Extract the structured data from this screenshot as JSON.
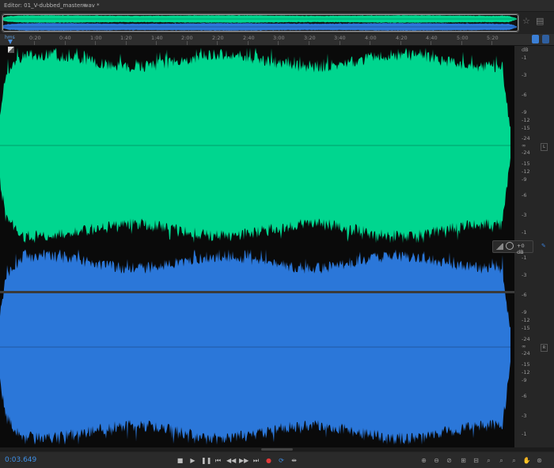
{
  "editor": {
    "title": "Editor: 01_V-dubbed_master.wav *",
    "menu_icon": "hamburger-menu-icon"
  },
  "colors": {
    "left_channel": "#00d68f",
    "right_channel": "#2b77d9",
    "accent": "#3e8fe6",
    "record": "#e03a3a"
  },
  "ruler": {
    "unit_label": "hms",
    "ticks": [
      "0:20",
      "0:40",
      "1:00",
      "1:20",
      "1:40",
      "2:00",
      "2:20",
      "2:40",
      "3:00",
      "3:20",
      "3:40",
      "4:00",
      "4:20",
      "4:40",
      "5:00",
      "5:20"
    ]
  },
  "db_scale": {
    "header": "dB",
    "left_labels": [
      "-1",
      "-3",
      "-6",
      "-9",
      "-12",
      "-15",
      "-24",
      "∞",
      "-24",
      "-15",
      "-12",
      "-9",
      "-6",
      "-3",
      "-1"
    ],
    "right_labels": [
      "-1",
      "-3",
      "-6",
      "-9",
      "-12",
      "-15",
      "-24",
      "∞",
      "-24",
      "-15",
      "-12",
      "-9",
      "-6",
      "-3",
      "-1"
    ],
    "left_channel_tag": "L",
    "right_channel_tag": "R"
  },
  "volume_hud": {
    "value": "+0 dB"
  },
  "transport": {
    "timecode": "0:03.649",
    "buttons": [
      "stop",
      "play",
      "pause",
      "go-to-start",
      "rewind",
      "fast-forward",
      "go-to-end",
      "record",
      "loop",
      "skip-selection"
    ]
  },
  "zoom": {
    "buttons": [
      "zoom-amplitude-in",
      "zoom-amplitude-out",
      "zoom-out-full",
      "zoom-in-time",
      "zoom-out-time",
      "zoom-in-at-start",
      "zoom-in-at-end",
      "zoom-to-selection",
      "zoom-out-full-both",
      "hand-tool",
      "zoom-selected"
    ]
  }
}
